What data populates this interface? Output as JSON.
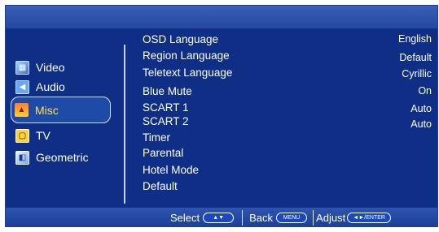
{
  "side_menu": {
    "items": [
      {
        "label": "Video",
        "icon": "film-icon"
      },
      {
        "label": "Audio",
        "icon": "speaker-icon"
      },
      {
        "label": "Misc",
        "icon": "misc-icon",
        "selected": true
      },
      {
        "label": "TV",
        "icon": "tv-icon"
      },
      {
        "label": "Geometric",
        "icon": "geometric-icon"
      }
    ]
  },
  "options": [
    {
      "label": "OSD Language",
      "value": "English"
    },
    {
      "label": "Region Language",
      "value": "Default"
    },
    {
      "label": "Teletext Language",
      "value": "Cyrillic"
    },
    {
      "label": "Blue Mute",
      "value": "On"
    },
    {
      "label": "SCART 1",
      "value": "Auto"
    },
    {
      "label": "SCART 2",
      "value": "Auto"
    },
    {
      "label": "Timer",
      "value": ""
    },
    {
      "label": "Parental",
      "value": ""
    },
    {
      "label": "Hotel Mode",
      "value": ""
    },
    {
      "label": "Default",
      "value": ""
    }
  ],
  "bottom_bar": {
    "select_label": "Select",
    "select_key": "▲▼",
    "back_label": "Back",
    "back_key": "MENU",
    "adjust_label": "Adjust",
    "adjust_key": "◄►/ENTER"
  },
  "colors": {
    "panel": "#0f2f86",
    "selected_text": "#ffe04a",
    "text": "#ffffff"
  }
}
